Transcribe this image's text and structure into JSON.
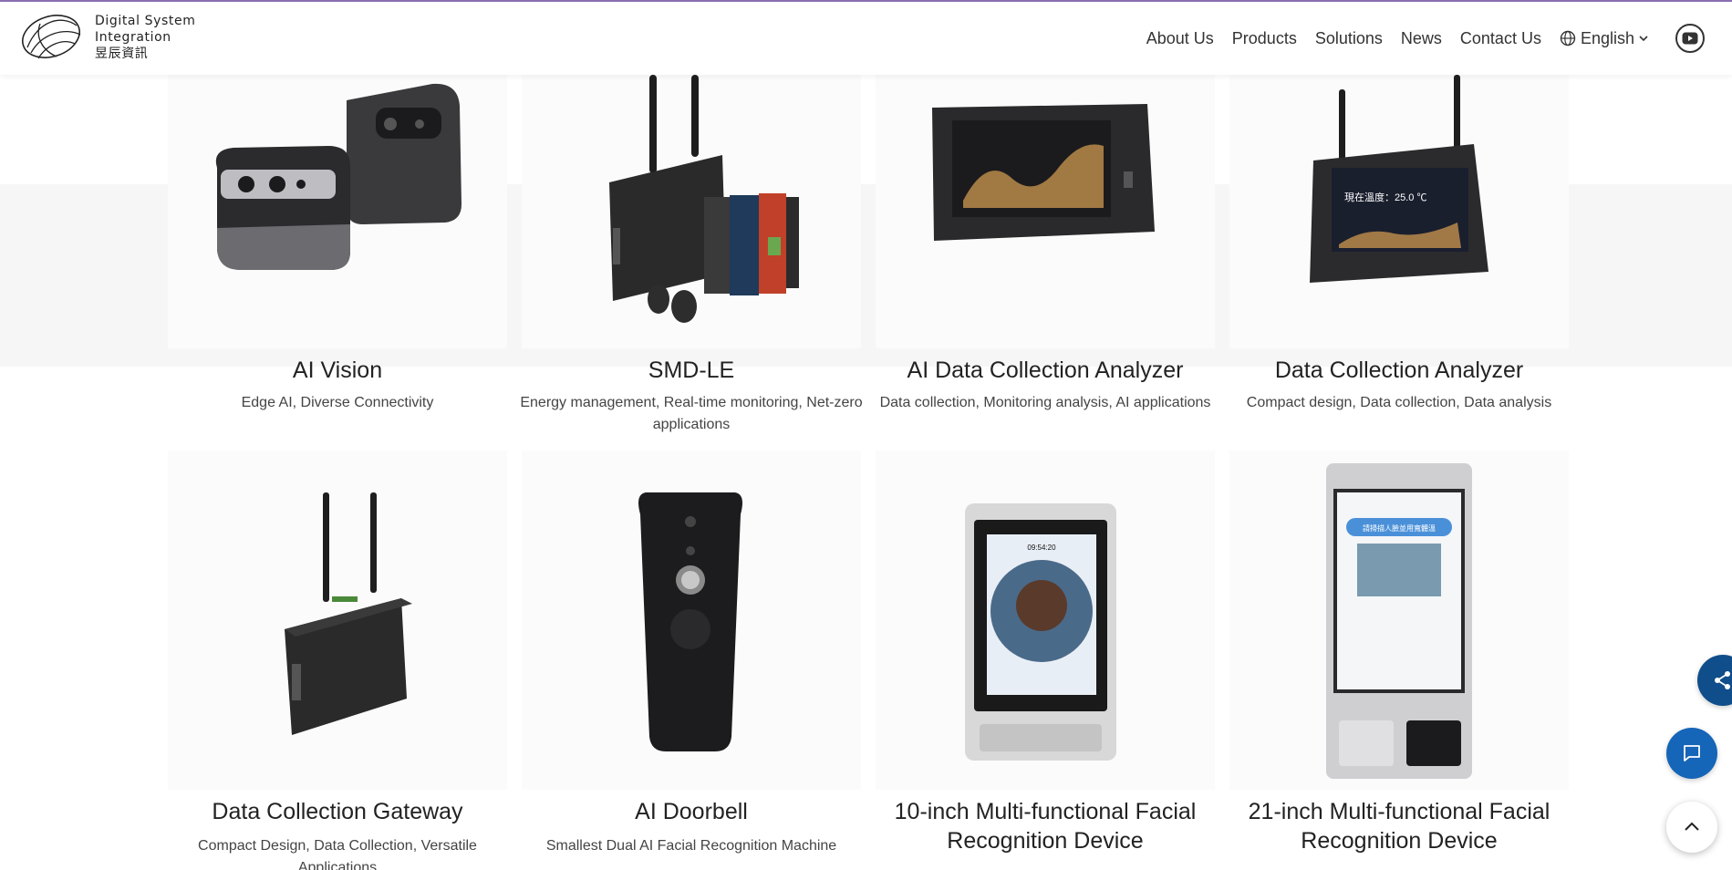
{
  "header": {
    "logo_lines": [
      "Digital System",
      "Integration",
      "昱辰資訊"
    ],
    "nav": [
      "About Us",
      "Products",
      "Solutions",
      "News",
      "Contact Us"
    ],
    "language": "English"
  },
  "products": [
    {
      "title": "AI Vision",
      "desc": "Edge AI, Diverse Connectivity",
      "icon": "ai-vision-camera"
    },
    {
      "title": "SMD-LE",
      "desc": "Energy management, Real-time monitoring, Net-zero applications",
      "icon": "smd-le-controller"
    },
    {
      "title": "AI Data Collection Analyzer",
      "desc": "Data collection, Monitoring analysis, AI applications",
      "icon": "analyzer-screen"
    },
    {
      "title": "Data Collection Analyzer",
      "desc": "Compact design, Data collection, Data analysis",
      "icon": "analyzer-screen-antenna"
    },
    {
      "title": "Data Collection Gateway",
      "desc": "Compact Design, Data Collection, Versatile Applications",
      "icon": "gateway-box"
    },
    {
      "title": "AI Doorbell",
      "desc": "Smallest Dual AI Facial Recognition Machine",
      "icon": "doorbell"
    },
    {
      "title": "10-inch Multi-functional Facial Recognition Device",
      "desc": "",
      "icon": "face-terminal-10"
    },
    {
      "title": "21-inch Multi-functional Facial Recognition Device",
      "desc": "",
      "icon": "face-kiosk-21"
    }
  ],
  "screen_text": {
    "temperature": "現在溫度：25.0 ℃",
    "time": "09:54:20",
    "kiosk_banner": "請掃描人臉並用寬體溫"
  },
  "fabs": [
    "share-icon",
    "chat-icon",
    "chevron-up-icon"
  ],
  "colors": {
    "accent": "#8a6fb0",
    "fab_dark": "#0f4e8a",
    "fab_blue": "#1565b8"
  }
}
